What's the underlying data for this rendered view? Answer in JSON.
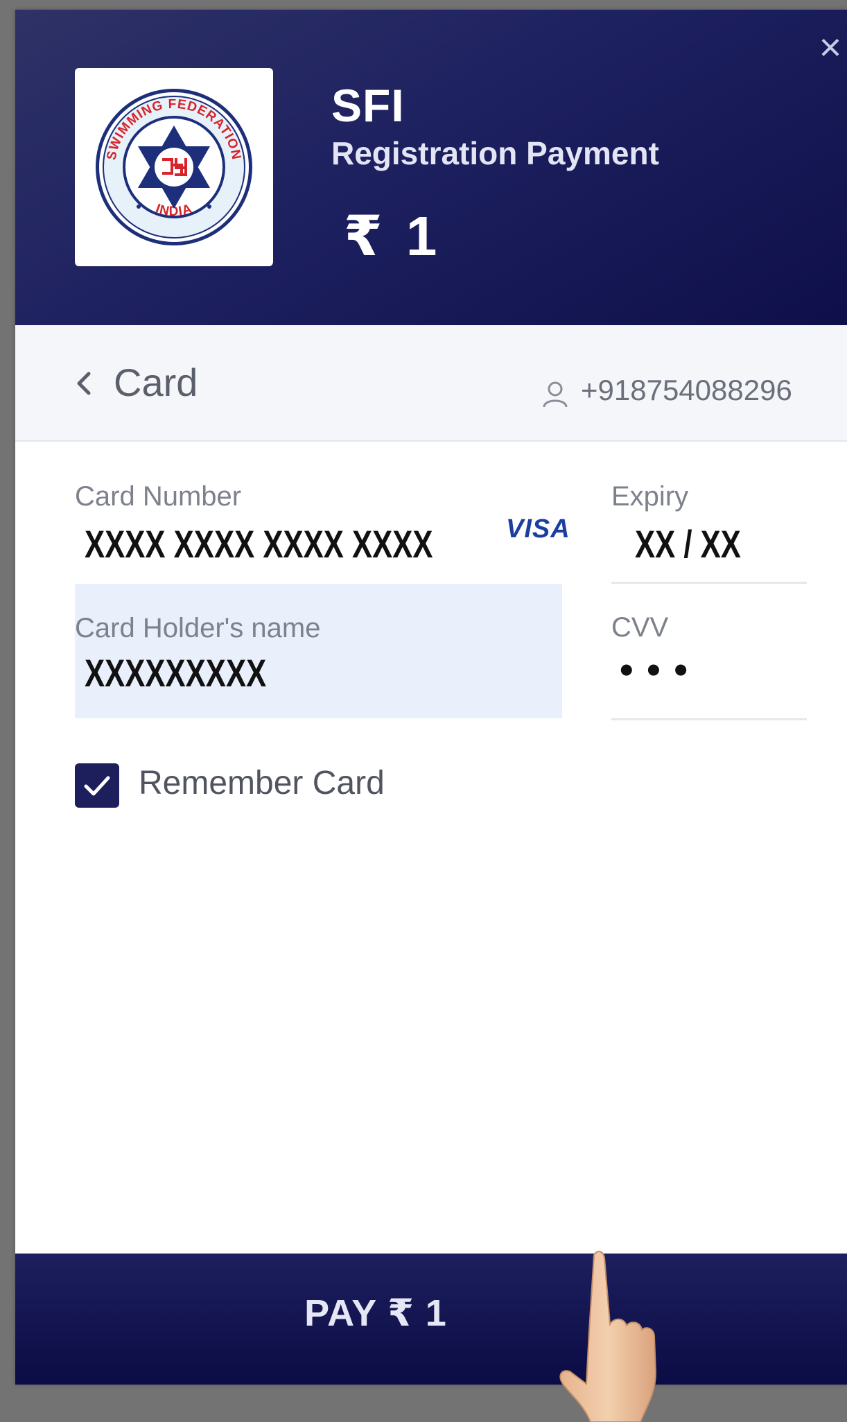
{
  "header": {
    "merchant_name": "SFI",
    "description": "Registration Payment",
    "amount": "₹ 1",
    "close_label": "×",
    "logo": {
      "top_text": "SWIMMING FEDERATION",
      "bottom_text": "INDIA",
      "emblem": "star-of-david-emblem"
    }
  },
  "subbar": {
    "back_icon": "chevron-left-icon",
    "method_title": "Card",
    "user_icon": "user-icon",
    "phone": "+918754088296"
  },
  "form": {
    "card_number": {
      "label": "Card Number",
      "value": "XXXX XXXX XXXX XXXX",
      "brand": "VISA"
    },
    "expiry": {
      "label": "Expiry",
      "value": "XX / XX"
    },
    "holder": {
      "label": "Card Holder's name",
      "value": "XXXXXXXXX"
    },
    "cvv": {
      "label": "CVV",
      "value": "• • •"
    },
    "remember": {
      "label": "Remember Card",
      "checked": true
    }
  },
  "footer": {
    "pay_label": "PAY ₹ 1"
  },
  "colors": {
    "header_bg": "#1e2160",
    "pay_button_bg": "#0b0c45",
    "checkbox_bg": "#1c1f5c",
    "holder_field_bg": "#e9effb",
    "overlay_bg": "#737373"
  }
}
